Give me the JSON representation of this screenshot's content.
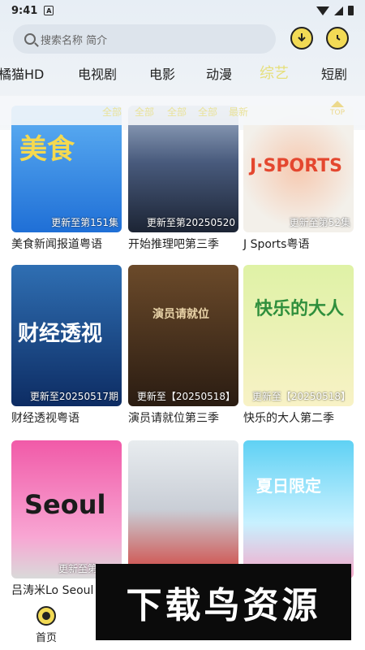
{
  "status": {
    "time": "9:41",
    "notif": "A"
  },
  "search": {
    "placeholder": "搜索名称 简介"
  },
  "categories": [
    "橘猫HD",
    "电视剧",
    "电影",
    "动漫",
    "综艺",
    "短剧"
  ],
  "active_category": "综艺",
  "filters": [
    "全部",
    "全部",
    "全部",
    "全部",
    "最新"
  ],
  "top_label": "TOP",
  "items": [
    {
      "title": "美食新闻报道粤语",
      "badge": "更新至第151集",
      "art_text": "美食",
      "colors": [
        "#1f6fd6",
        "#5fb1f4",
        "#f5d94f"
      ]
    },
    {
      "title": "开始推理吧第三季",
      "badge": "更新至第20250520",
      "art_text": "",
      "colors": [
        "#1c2434",
        "#485a7c",
        "#d7dce6"
      ]
    },
    {
      "title": "J Sports粤语",
      "badge": "更新至第52集",
      "art_text": "J·SPORTS",
      "colors": [
        "#f3f0ea",
        "#f6c9b0",
        "#e4472f"
      ]
    },
    {
      "title": "财经透视粤语",
      "badge": "更新至20250517期",
      "art_text": "财经透视",
      "colors": [
        "#0d2c63",
        "#2f6fb3",
        "#a8c6e8"
      ]
    },
    {
      "title": "演员请就位第三季",
      "badge": "更新至【20250518】",
      "art_text": "演员请就位",
      "colors": [
        "#2a1c12",
        "#6b4a2a",
        "#c9a26b"
      ]
    },
    {
      "title": "快乐的大人第二季",
      "badge": "更新至【20250518】",
      "art_text": "快乐的大人",
      "colors": [
        "#dff2a6",
        "#f8f2c6",
        "#66b36d"
      ]
    },
    {
      "title": "吕涛米Lo Seoul",
      "badge": "更新至第",
      "art_text": "Seoul",
      "colors": [
        "#f15aa8",
        "#f8a6d3",
        "#1b1b1b"
      ]
    },
    {
      "title": "",
      "badge": "",
      "art_text": "",
      "colors": [
        "#e8ecef",
        "#d1403a",
        "#2e3b4f"
      ]
    },
    {
      "title": "",
      "badge": "",
      "art_text": "夏日限定",
      "colors": [
        "#5fd1f4",
        "#c8f1ff",
        "#f5a8c9"
      ]
    }
  ],
  "watermark": "下载鸟资源",
  "nav": {
    "home": "首页"
  }
}
